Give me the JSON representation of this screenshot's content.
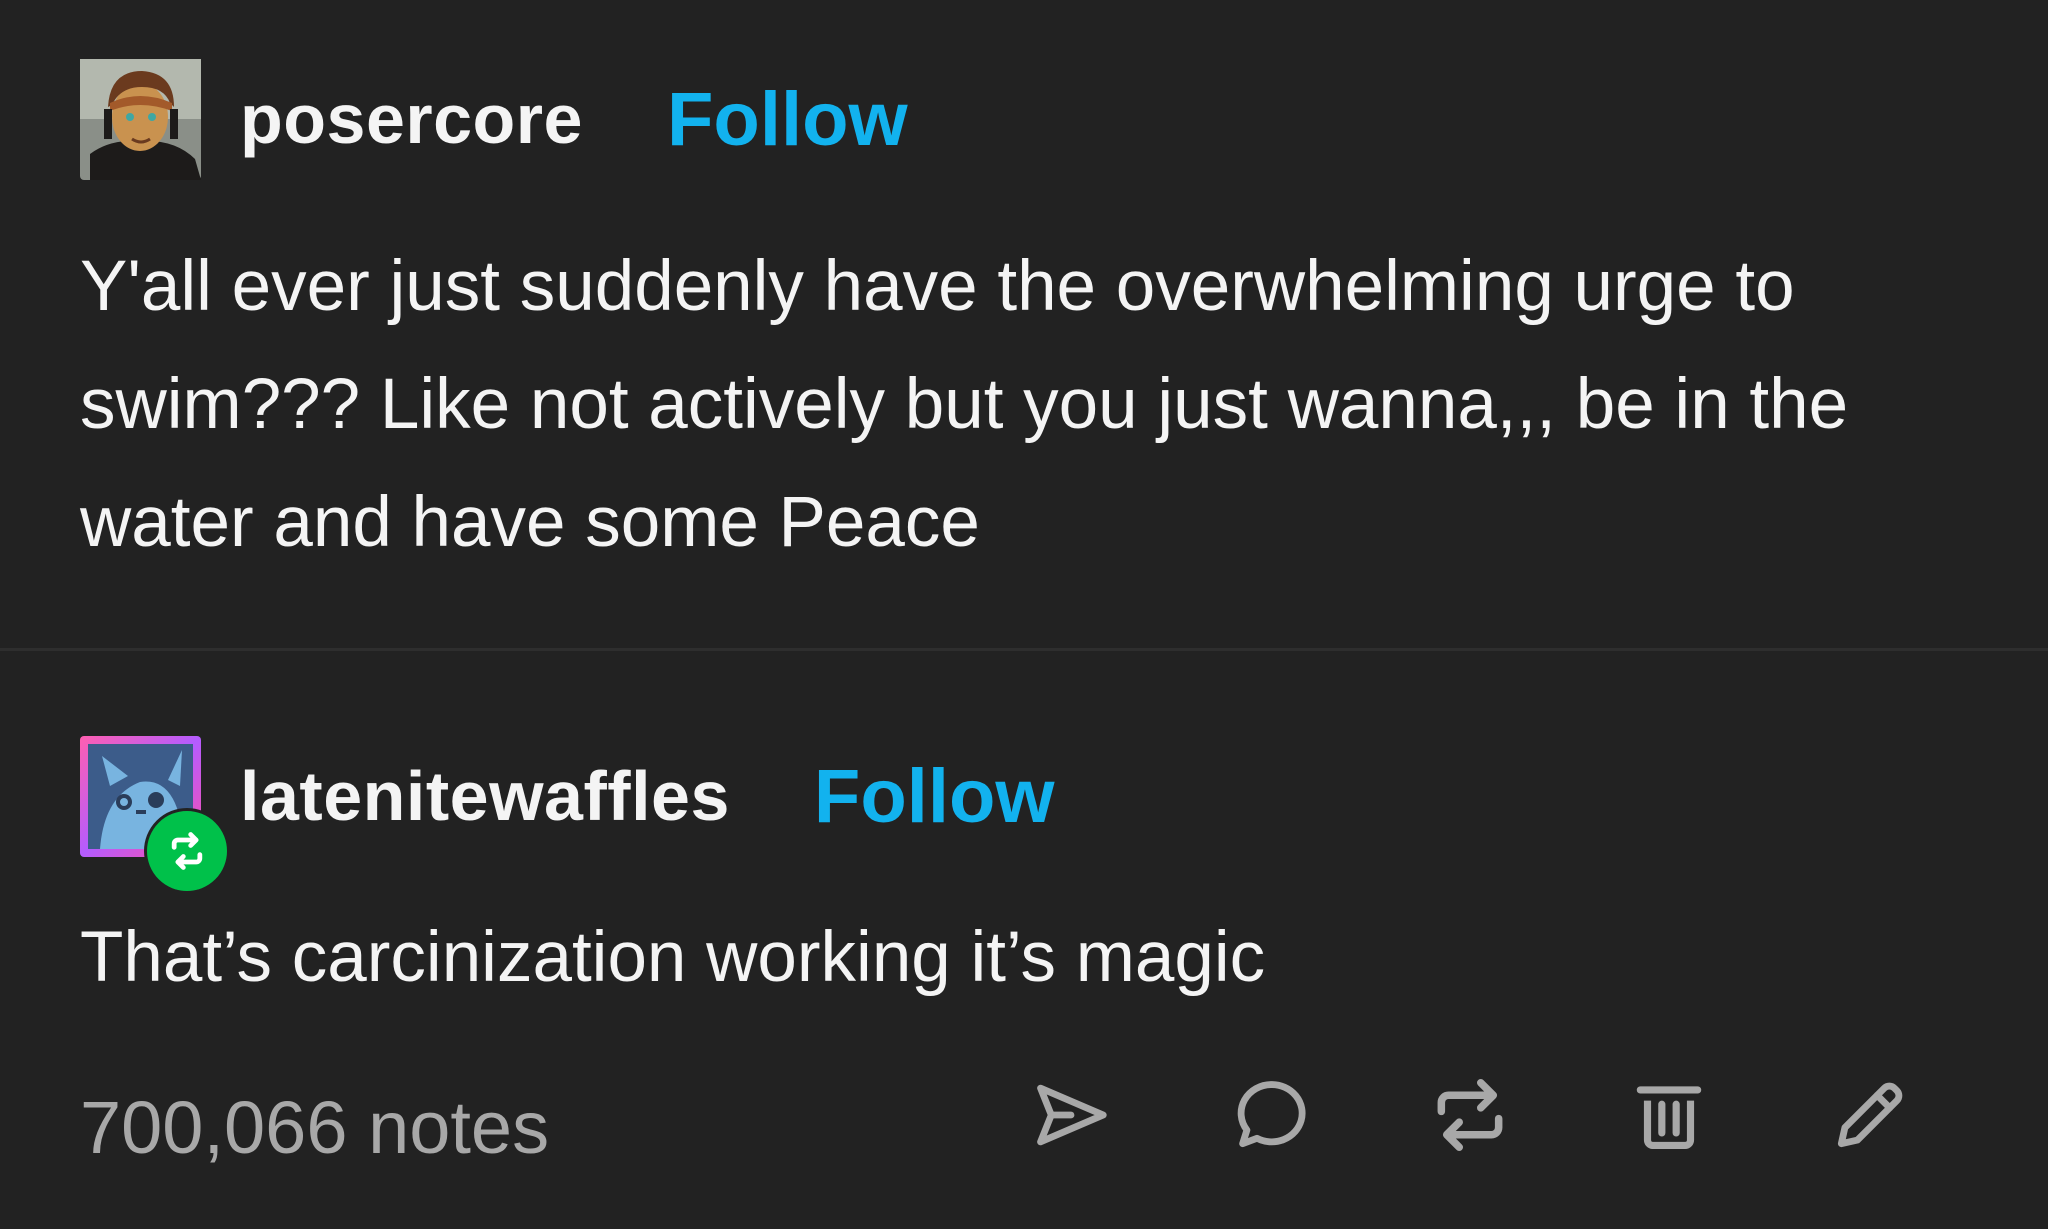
{
  "posts": [
    {
      "username": "posercore",
      "follow_label": "Follow",
      "text": "Y'all ever just suddenly have the overwhelming urge to swim??? Like not actively but you just wanna,,, be in the water and have some Peace"
    },
    {
      "username": "latenitewaffles",
      "follow_label": "Follow",
      "text": "That’s carcinization working it’s magic"
    }
  ],
  "footer": {
    "notes_count": "700,066",
    "notes_label": "notes",
    "actions": [
      {
        "icon": "send-icon"
      },
      {
        "icon": "reply-icon"
      },
      {
        "icon": "reblog-icon"
      },
      {
        "icon": "delete-icon"
      },
      {
        "icon": "edit-icon"
      }
    ]
  },
  "colors": {
    "background": "#222222",
    "text": "#f4f4f4",
    "follow": "#12b2ee",
    "notes": "#a8a8a8",
    "reblog_badge": "#00c14a"
  }
}
